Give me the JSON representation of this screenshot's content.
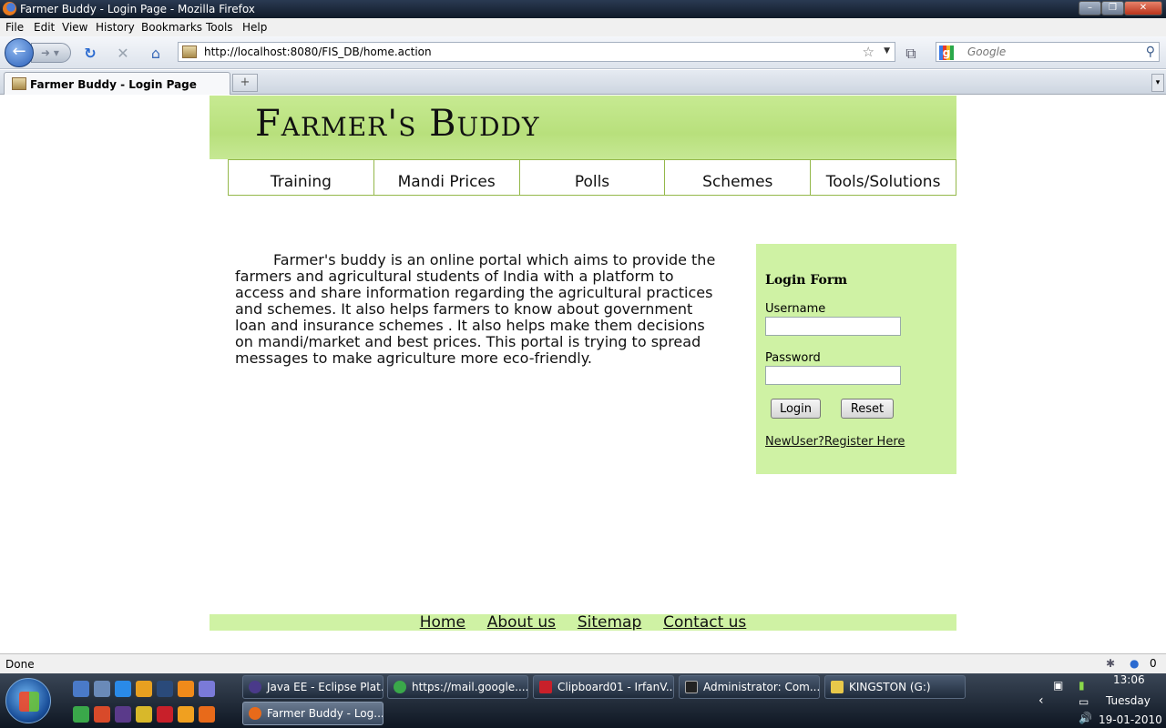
{
  "window": {
    "title": "Farmer Buddy - Login Page - Mozilla Firefox"
  },
  "menu": [
    "File",
    "Edit",
    "View",
    "History",
    "Bookmarks",
    "Tools",
    "Help"
  ],
  "browser": {
    "url": "http://localhost:8080/FIS_DB/home.action",
    "search_placeholder": "Google",
    "tab_title": "Farmer Buddy - Login Page",
    "new_tab_symbol": "+",
    "status": "Done",
    "status_count": "0"
  },
  "site": {
    "logo": "Farmer's Buddy",
    "nav": [
      "Training",
      "Mandi Prices",
      "Polls",
      "Schemes",
      "Tools/Solutions"
    ],
    "intro": "Farmer's buddy is an online portal which aims to provide the farmers and agricultural students of India with a platform to access and share information regarding the agricultural practices and schemes. It also helps farmers to know about government loan and insurance schemes . It also helps make them decisions on mandi/market and best prices. This portal is trying to spread messages to make agriculture more eco-friendly.",
    "login": {
      "title": "Login Form",
      "username_label": "Username",
      "password_label": "Password",
      "login_button": "Login",
      "reset_button": "Reset",
      "register_link": "NewUser?Register Here"
    },
    "footer": [
      "Home",
      "About us",
      "Sitemap",
      "Contact us"
    ]
  },
  "taskbar": {
    "tasks": [
      "Java EE - Eclipse Plat...",
      "https://mail.google....",
      "Clipboard01 - IrfanV...",
      "Administrator: Com...",
      "KINGSTON (G:)",
      "Farmer Buddy - Log..."
    ],
    "clock_time": "13:06",
    "clock_day": "Tuesday",
    "clock_date": "19-01-2010"
  }
}
